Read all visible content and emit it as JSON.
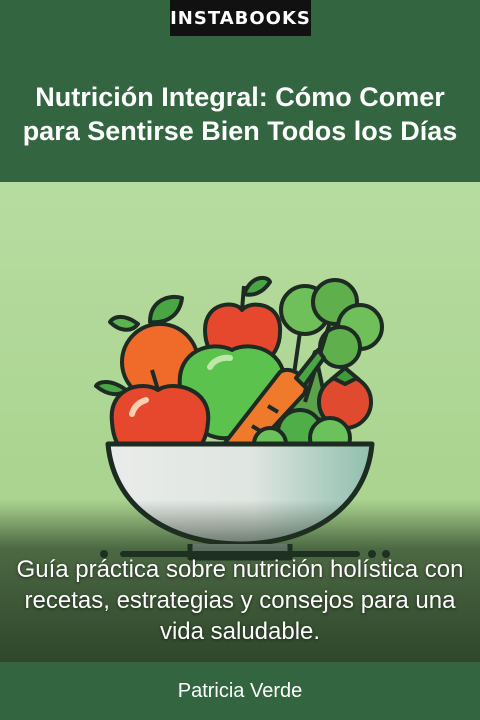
{
  "brand": "INSTABOOKS",
  "title": "Nutrición Integral: Cómo Comer para Sentirse Bien Todos los Días",
  "subtitle": "Guía práctica sobre nutrición holística con recetas, estrategias y consejos para una vida saludable.",
  "author": "Patricia Verde",
  "colors": {
    "band": "#336640",
    "art_background": "#b9dca0",
    "brand_tag": "#111111"
  },
  "illustration": {
    "subject": "bowl-of-fruits-and-vegetables",
    "items": [
      "apple-icon",
      "orange-icon",
      "green-apple-icon",
      "carrot-icon",
      "broccoli-icon",
      "tomato-icon",
      "bowl-icon"
    ]
  }
}
